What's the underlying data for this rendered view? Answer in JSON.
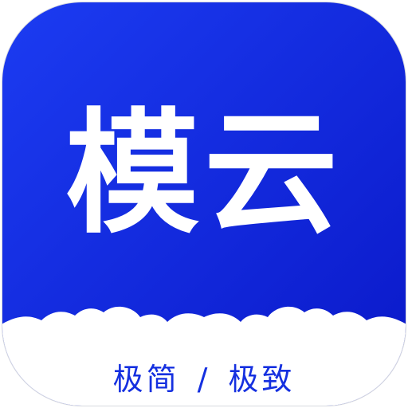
{
  "app_icon": {
    "brand_name": "模云",
    "tagline": {
      "part1": "极简",
      "separator": "/",
      "part2": "极致"
    },
    "colors": {
      "gradient_start": "#1c3cf2",
      "gradient_end": "#0a18c8",
      "text": "#ffffff",
      "tagline": "#1530e0",
      "cloud": "#ffffff",
      "border": "#d7d9de"
    }
  }
}
